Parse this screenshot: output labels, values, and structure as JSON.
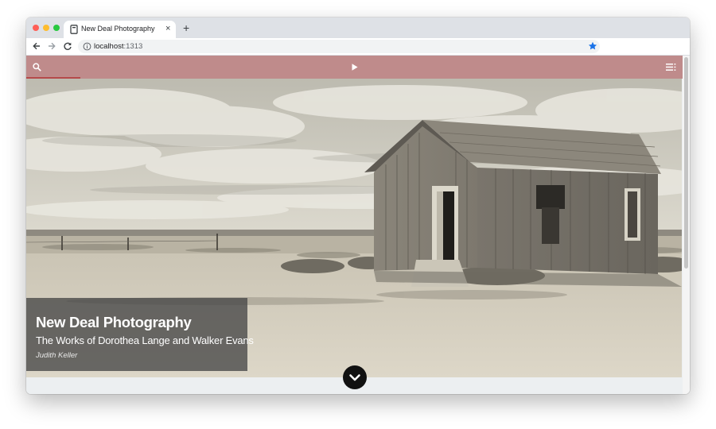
{
  "browser": {
    "tab": {
      "title": "New Deal Photography",
      "close_glyph": "×",
      "favicon": "document-icon"
    },
    "new_tab_glyph": "+",
    "address": {
      "host": "localhost",
      "port": ":1313"
    },
    "icons": [
      "back-arrow-icon",
      "forward-arrow-icon",
      "reload-icon",
      "info-icon",
      "star-icon"
    ],
    "star_color": "#1a73e8"
  },
  "site": {
    "header_color": "#bf8b8b",
    "progress_color": "#b54a4a",
    "icons": [
      "search-icon",
      "play-icon",
      "menu-icon"
    ]
  },
  "hero": {
    "title": "New Deal Photography",
    "subtitle": "The Works of Dorothea Lange and Walker Evans",
    "author": "Judith Keller",
    "image": "sepia photograph of an abandoned wooden shack on an open plain"
  },
  "scroll_button": {
    "icon": "chevron-down-icon"
  }
}
